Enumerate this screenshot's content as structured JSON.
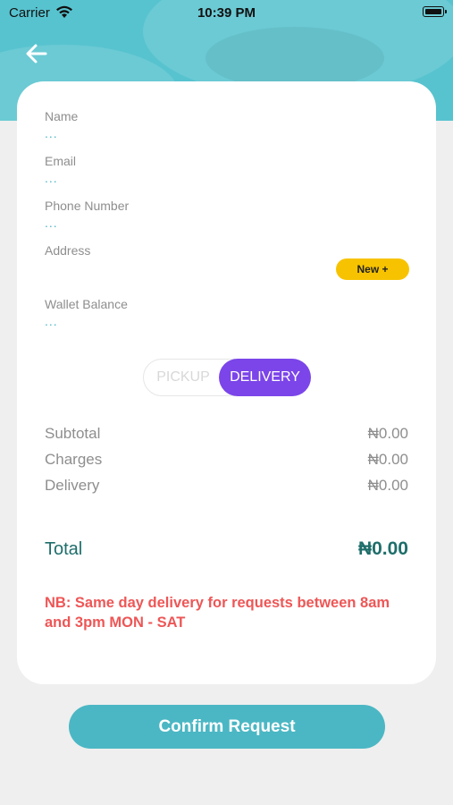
{
  "status_bar": {
    "carrier": "Carrier",
    "time": "10:39 PM"
  },
  "header": {
    "back_icon": "back-arrow-icon"
  },
  "fields": [
    {
      "label": "Name",
      "value": "..."
    },
    {
      "label": "Email",
      "value": "..."
    },
    {
      "label": "Phone Number",
      "value": "..."
    },
    {
      "label": "Address",
      "value": ""
    },
    {
      "label": "Wallet Balance",
      "value": "..."
    }
  ],
  "new_button": "New +",
  "toggle": {
    "pickup": "PICKUP",
    "delivery": "DELIVERY",
    "selected": "DELIVERY"
  },
  "summary": [
    {
      "label": "Subtotal",
      "value": "₦0.00"
    },
    {
      "label": "Charges",
      "value": "₦0.00"
    },
    {
      "label": "Delivery",
      "value": "₦0.00"
    }
  ],
  "total": {
    "label": "Total",
    "value": "₦0.00"
  },
  "note": "NB: Same day delivery for requests between 8am and 3pm MON - SAT",
  "confirm_button": "Confirm Request",
  "colors": {
    "header": "#57c3cf",
    "accent": "#4bb7c4",
    "toggle_active": "#7b45e9",
    "new_button": "#f7c300",
    "note": "#ee5656",
    "total": "#1f6e6b"
  }
}
